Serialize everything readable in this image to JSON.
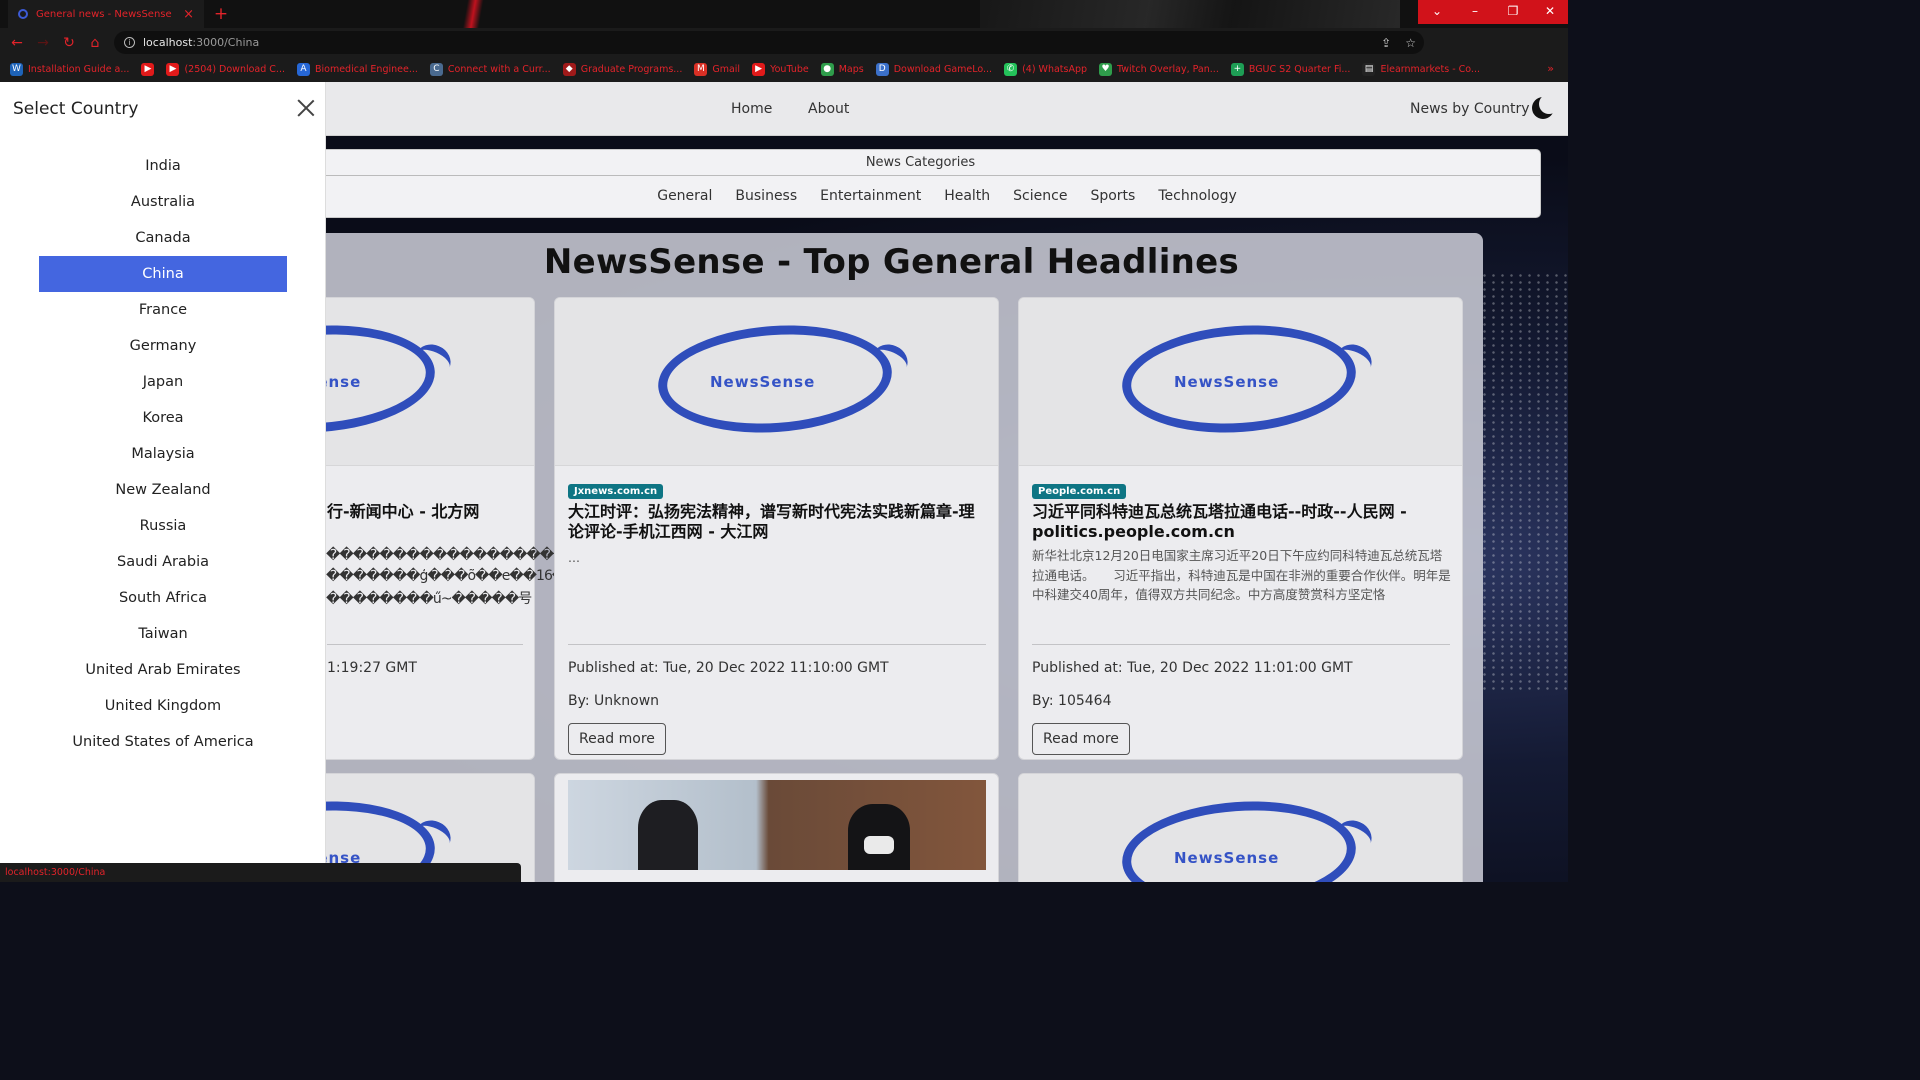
{
  "browser": {
    "tab_title": "General news - NewsSense",
    "tab_close": "×",
    "new_tab": "+",
    "url_host": "localhost",
    "url_path": ":3000/China",
    "window_controls": [
      "⌄",
      "–",
      "❐",
      "✕"
    ],
    "bookmarks": [
      {
        "label": "Installation Guide a...",
        "icon": "wordpress-icon",
        "color": "#1e63b8",
        "glyph": "W"
      },
      {
        "label": "",
        "icon": "youtube-icon",
        "color": "#e11a1a",
        "glyph": "▶"
      },
      {
        "label": "(2504) Download C...",
        "icon": "youtube-icon",
        "color": "#e11a1a",
        "glyph": "▶"
      },
      {
        "label": "Biomedical Enginee...",
        "icon": "azure-icon",
        "color": "#2667d6",
        "glyph": "A"
      },
      {
        "label": "Connect with a Curr...",
        "icon": "site-icon",
        "color": "#4a6a8f",
        "glyph": "C"
      },
      {
        "label": "Graduate Programs...",
        "icon": "site-icon",
        "color": "#a01a1a",
        "glyph": "◆"
      },
      {
        "label": "Gmail",
        "icon": "gmail-icon",
        "color": "#d93025",
        "glyph": "M"
      },
      {
        "label": "YouTube",
        "icon": "youtube-icon",
        "color": "#e11a1a",
        "glyph": "▶"
      },
      {
        "label": "Maps",
        "icon": "maps-icon",
        "color": "#2f9d4b",
        "glyph": "●"
      },
      {
        "label": "Download GameLo...",
        "icon": "site-icon",
        "color": "#3b70c9",
        "glyph": "D"
      },
      {
        "label": "(4) WhatsApp",
        "icon": "whatsapp-icon",
        "color": "#24c25a",
        "glyph": "✆"
      },
      {
        "label": "Twitch Overlay, Pan...",
        "icon": "site-icon",
        "color": "#2f9d4b",
        "glyph": "♥"
      },
      {
        "label": "BGUC S2 Quarter Fi...",
        "icon": "sheets-icon",
        "color": "#1e9e55",
        "glyph": "+"
      },
      {
        "label": "Elearnmarkets - Co...",
        "icon": "site-icon",
        "color": "#222",
        "glyph": "▤"
      }
    ],
    "bookmarks_more": "»",
    "status_text": "localhost:3000/China"
  },
  "navbar": {
    "home": "Home",
    "about": "About",
    "country": "News by Country"
  },
  "categories": {
    "title": "News Categories",
    "items": [
      "General",
      "Business",
      "Entertainment",
      "Health",
      "Science",
      "Sports",
      "Technology"
    ]
  },
  "main": {
    "headline": "NewsSense - Top General Headlines",
    "logo_text": "NewsSense",
    "cards": [
      {
        "title_visible": "行-新闻中心 - 北方网",
        "desc_visible": [
          "������������������",
          "�������ģ���õ��e��16����",
          "��������ű~�����号"
        ],
        "published_visible": "1:19:27 GMT"
      },
      {
        "source": "Jxnews.com.cn",
        "title": "大江时评：弘扬宪法精神，谱写新时代宪法实践新篇章-理论评论-手机江西网 - 大江网",
        "desc": "...",
        "published": "Published at: Tue, 20 Dec 2022 11:10:00 GMT",
        "author": "By: Unknown",
        "button": "Read more"
      },
      {
        "source": "People.com.cn",
        "title": "习近平同科特迪瓦总统瓦塔拉通电话--时政--人民网 - politics.people.com.cn",
        "desc": "新华社北京12月20日电国家主席习近平20日下午应约同科特迪瓦总统瓦塔拉通电话。　　习近平指出，科特迪瓦是中国在非洲的重要合作伙伴。明年是中科建交40周年，值得双方共同纪念。中方高度赞赏科方坚定恪",
        "published": "Published at: Tue, 20 Dec 2022 11:01:00 GMT",
        "author": "By: 105464",
        "button": "Read more"
      }
    ]
  },
  "sidebar": {
    "title": "Select Country",
    "selected": "China",
    "countries": [
      "India",
      "Australia",
      "Canada",
      "China",
      "France",
      "Germany",
      "Japan",
      "Korea",
      "Malaysia",
      "New Zealand",
      "Russia",
      "Saudi Arabia",
      "South Africa",
      "Taiwan",
      "United Arab Emirates",
      "United Kingdom",
      "United States of America"
    ]
  },
  "colors": {
    "accent_selected": "#4466e0",
    "browser_red": "#e2232a",
    "source_badge": "#0e7584",
    "logo_blue": "#2f4dbb"
  }
}
